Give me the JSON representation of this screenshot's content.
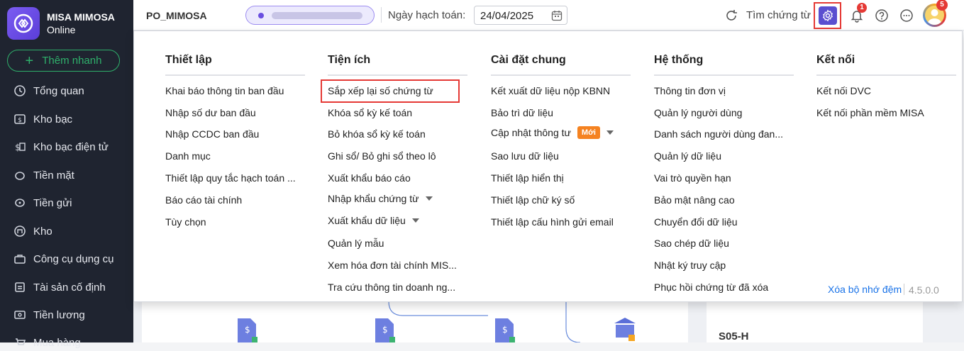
{
  "app": {
    "name": "MISA MIMOSA",
    "edition": "Online"
  },
  "sidebar": {
    "quick_add": "Thêm nhanh",
    "items": [
      {
        "label": "Tổng quan",
        "icon": "clock-icon"
      },
      {
        "label": "Kho bạc",
        "icon": "treasury-icon"
      },
      {
        "label": "Kho bạc điện tử",
        "icon": "e-treasury-icon"
      },
      {
        "label": "Tiền mặt",
        "icon": "cash-icon"
      },
      {
        "label": "Tiền gửi",
        "icon": "deposit-icon"
      },
      {
        "label": "Kho",
        "icon": "warehouse-icon"
      },
      {
        "label": "Công cụ dụng cụ",
        "icon": "tools-icon"
      },
      {
        "label": "Tài sản cố định",
        "icon": "fixed-asset-icon"
      },
      {
        "label": "Tiền lương",
        "icon": "salary-icon"
      },
      {
        "label": "Mua hàng",
        "icon": "purchase-icon"
      }
    ]
  },
  "topbar": {
    "db_name": "PO_MIMOSA",
    "accounting_date_label": "Ngày hạch toán:",
    "accounting_date": "24/04/2025",
    "search_label": "Tìm chứng từ",
    "notification_count": "1",
    "avatar_badge": "5"
  },
  "menu": {
    "columns": [
      {
        "title": "Thiết lập",
        "items": [
          "Khai báo thông tin ban đầu",
          "Nhập số dư ban đầu",
          "Nhập CCDC ban đầu",
          "Danh mục",
          "Thiết lập quy tắc hạch toán ...",
          "Báo cáo tài chính",
          "Tùy chọn"
        ]
      },
      {
        "title": "Tiện ích",
        "items": [
          "Sắp xếp lại số chứng từ",
          "Khóa sổ kỳ kế toán",
          "Bỏ khóa sổ kỳ kế toán",
          "Ghi sổ/ Bỏ ghi sổ theo lô",
          "Xuất khẩu báo cáo",
          "Nhập khẩu chứng từ",
          "Xuất khẩu dữ liệu",
          "Quản lý mẫu",
          "Xem hóa đơn tài chính MIS...",
          "Tra cứu thông tin doanh ng..."
        ]
      },
      {
        "title": "Cài đặt chung",
        "items": [
          "Kết xuất dữ liệu nộp KBNN",
          "Bảo trì dữ liệu",
          "Cập nhật thông tư",
          "Sao lưu dữ liệu",
          "Thiết lập hiển thị",
          "Thiết lập chữ ký số",
          "Thiết lập cấu hình gửi email"
        ],
        "new_badge": "Mới"
      },
      {
        "title": "Hệ thống",
        "items": [
          "Thông tin đơn vị",
          "Quản lý người dùng",
          "Danh sách người dùng đan...",
          "Quản lý dữ liệu",
          "Vai trò quyền hạn",
          "Bảo mật nâng cao",
          "Chuyển đổi dữ liệu",
          "Sao chép dữ liệu",
          "Nhật ký truy cập",
          "Phục hồi chứng từ đã xóa"
        ]
      },
      {
        "title": "Kết nối",
        "items": [
          "Kết nối DVC",
          "Kết nối phần mềm MISA"
        ]
      }
    ],
    "clear_cache": "Xóa bộ nhớ đệm",
    "version": "4.5.0.0"
  },
  "background": {
    "report_code": "S05-H"
  },
  "colors": {
    "sidebar_bg": "#1f2430",
    "accent": "#5a4fd0",
    "highlight": "#e53935",
    "quick_add": "#2fb06b",
    "new_badge": "#f58220"
  }
}
